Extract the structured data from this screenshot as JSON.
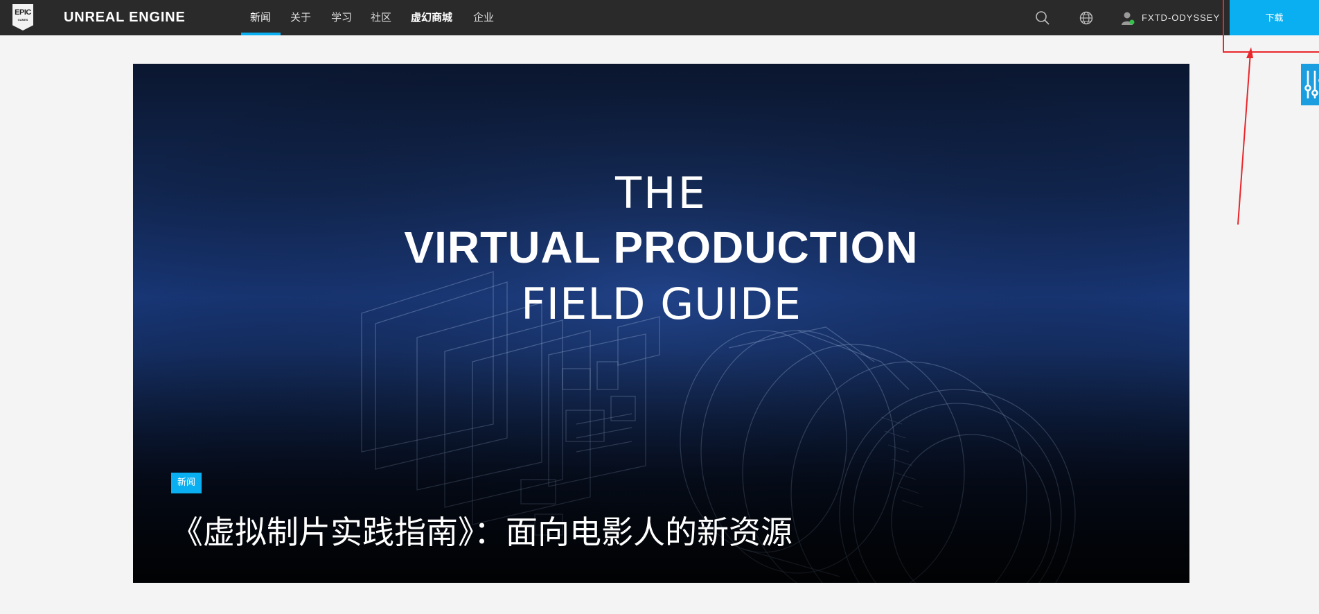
{
  "header": {
    "logo": {
      "line1": "EPIC",
      "line2": "GAMES"
    },
    "brand": "UNREAL ENGINE",
    "nav": [
      {
        "label": "新闻"
      },
      {
        "label": "关于"
      },
      {
        "label": "学习"
      },
      {
        "label": "社区"
      },
      {
        "label": "虚幻商城"
      },
      {
        "label": "企业"
      }
    ],
    "active_nav": "新闻",
    "icons": {
      "search": "search-icon",
      "language": "globe-icon",
      "user": "user-icon",
      "filter": "sliders-icon"
    },
    "user": {
      "name": "FXTD-ODYSSEY",
      "status": "online"
    },
    "download_label": "下载"
  },
  "hero": {
    "title_line1": "THE",
    "title_line2": "VIRTUAL PRODUCTION",
    "title_line3": "FIELD GUIDE",
    "tag": "新闻",
    "headline": "《虚拟制片实践指南》：面向电影人的新资源"
  },
  "colors": {
    "nav_bg": "#2a2a2a",
    "accent": "#0aaff1",
    "annotation": "#e8262b",
    "page_bg": "#f4f4f4"
  }
}
